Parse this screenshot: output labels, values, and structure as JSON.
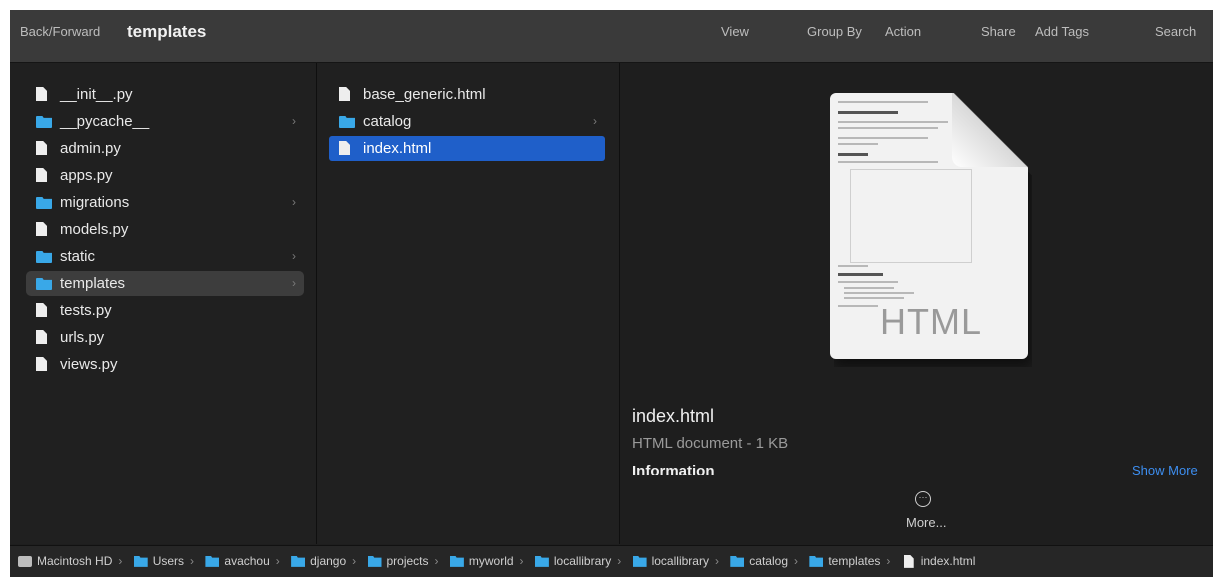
{
  "toolbar": {
    "back_forward": "Back/Forward",
    "title": "templates",
    "view": "View",
    "group_by": "Group By",
    "action": "Action",
    "share": "Share",
    "add_tags": "Add Tags",
    "search": "Search"
  },
  "column1": {
    "items": [
      {
        "label": "__init__.py",
        "icon": "file-icon",
        "folder": false
      },
      {
        "label": "__pycache__",
        "icon": "folder-icon",
        "folder": true
      },
      {
        "label": "admin.py",
        "icon": "file-icon",
        "folder": false
      },
      {
        "label": "apps.py",
        "icon": "file-icon",
        "folder": false
      },
      {
        "label": "migrations",
        "icon": "folder-icon",
        "folder": true
      },
      {
        "label": "models.py",
        "icon": "file-icon",
        "folder": false
      },
      {
        "label": "static",
        "icon": "folder-icon",
        "folder": true
      },
      {
        "label": "templates",
        "icon": "folder-icon",
        "folder": true,
        "selected": true
      },
      {
        "label": "tests.py",
        "icon": "file-icon",
        "folder": false
      },
      {
        "label": "urls.py",
        "icon": "file-icon",
        "folder": false
      },
      {
        "label": "views.py",
        "icon": "file-icon",
        "folder": false
      }
    ]
  },
  "column2": {
    "items": [
      {
        "label": "base_generic.html",
        "icon": "file-icon",
        "folder": false
      },
      {
        "label": "catalog",
        "icon": "folder-icon",
        "folder": true
      },
      {
        "label": "index.html",
        "icon": "file-icon",
        "folder": false,
        "selected": true
      }
    ]
  },
  "preview": {
    "doc_label": "HTML",
    "file_name": "index.html",
    "file_kind": "HTML document - 1 KB",
    "info_heading": "Information",
    "show_more": "Show More",
    "more_label": "More..."
  },
  "pathbar": {
    "crumbs": [
      {
        "label": "Macintosh HD",
        "icon": "disk-icon"
      },
      {
        "label": "Users",
        "icon": "folder-icon"
      },
      {
        "label": "avachou",
        "icon": "folder-icon"
      },
      {
        "label": "django",
        "icon": "folder-icon"
      },
      {
        "label": "projects",
        "icon": "folder-icon"
      },
      {
        "label": "myworld",
        "icon": "folder-icon"
      },
      {
        "label": "locallibrary",
        "icon": "folder-icon"
      },
      {
        "label": "locallibrary",
        "icon": "folder-icon"
      },
      {
        "label": "catalog",
        "icon": "folder-icon"
      },
      {
        "label": "templates",
        "icon": "folder-icon"
      },
      {
        "label": "index.html",
        "icon": "file-icon"
      }
    ]
  },
  "colors": {
    "selection_blue": "#1f5fc9",
    "folder_blue": "#39a8e8",
    "link_blue": "#3d8ef0"
  }
}
